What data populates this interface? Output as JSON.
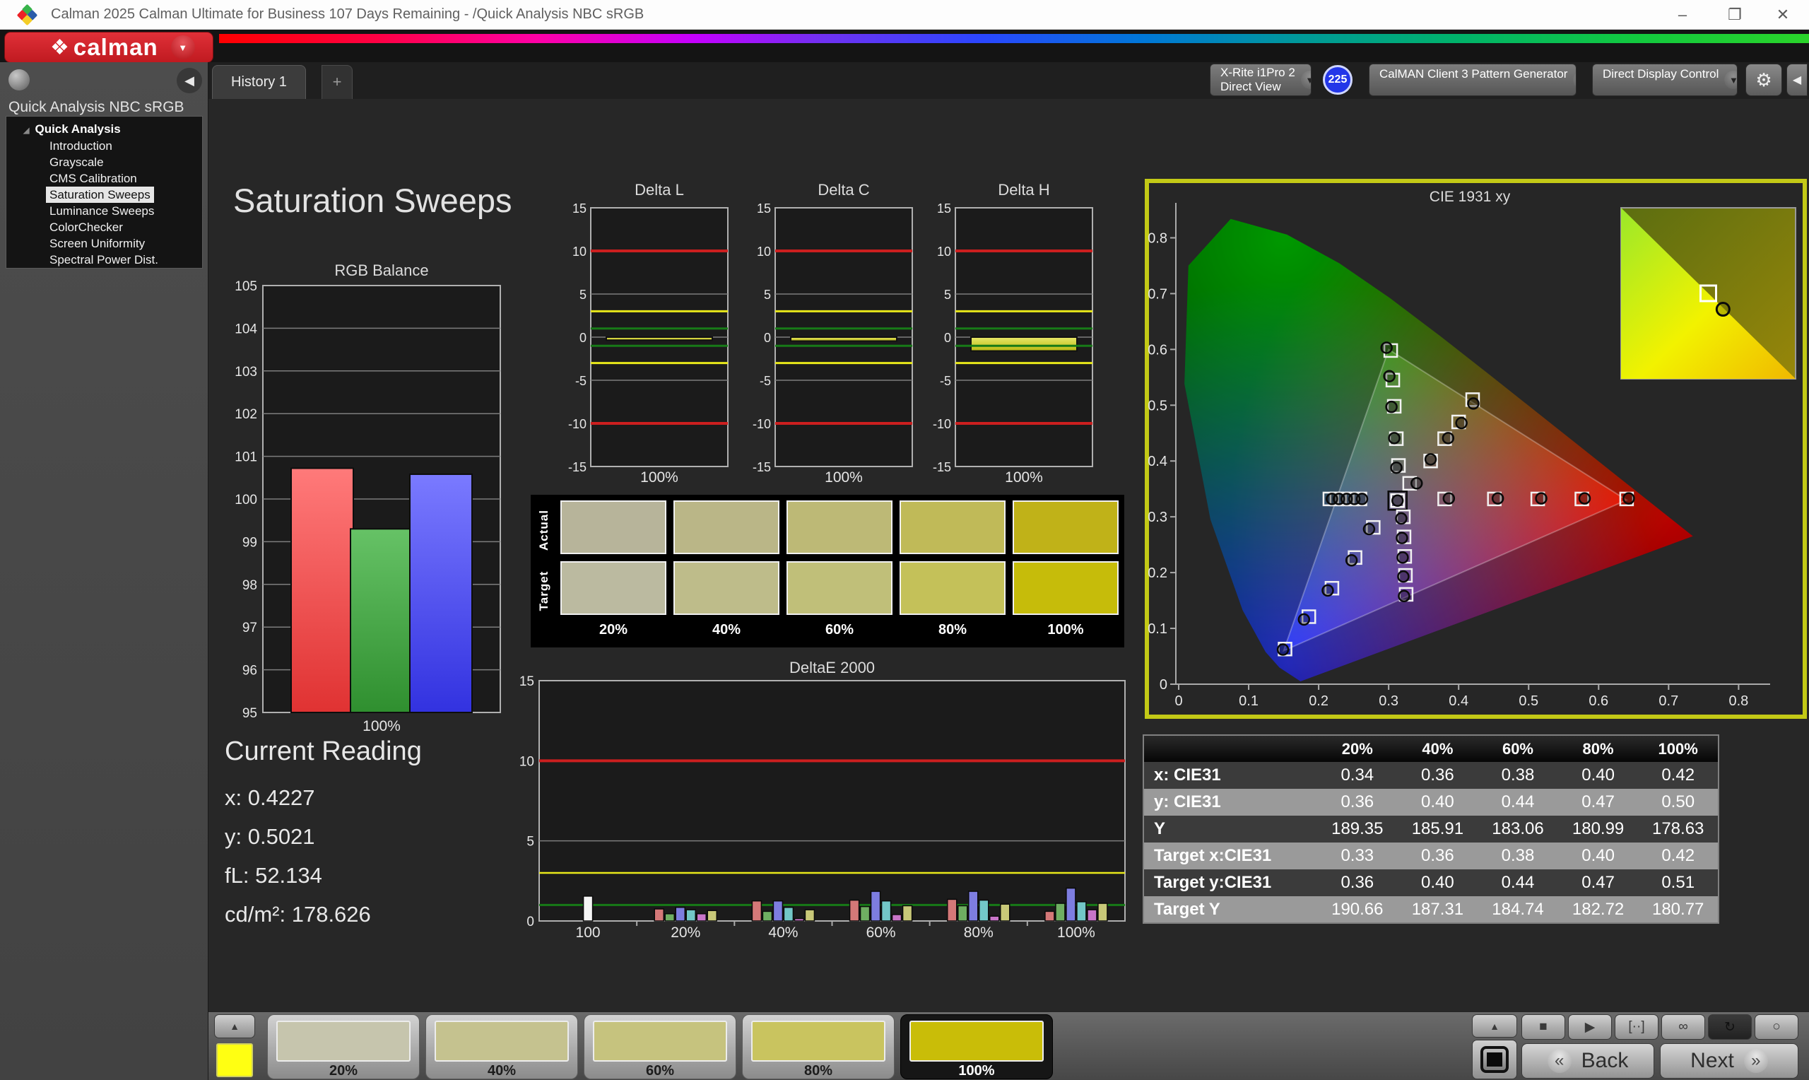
{
  "window": {
    "title": "Calman 2025 Calman Ultimate for Business 107 Days Remaining  - /Quick Analysis NBC sRGB"
  },
  "brand": {
    "logo_text": "calman",
    "logo_glyph": "❖"
  },
  "tab_bar": {
    "tabs": [
      {
        "label": "History 1",
        "active": true
      }
    ],
    "add_button": "+"
  },
  "toolbar": {
    "meter_dropdown": {
      "line1": "X-Rite i1Pro 2",
      "line2": "Direct View",
      "accent_color": "#3fd43f",
      "badge": "225",
      "badge_color": "#2336e8"
    },
    "source_dropdown": {
      "label": "CalMAN Client 3 Pattern Generator",
      "accent_color": "#3fd43f"
    },
    "display_dropdown": {
      "label": "Direct Display Control",
      "accent_color": "#e6e62a"
    },
    "settings_glyph": "⚙",
    "collapse_glyph": "◀"
  },
  "sidebar": {
    "workflow_title": "Quick Analysis NBC sRGB",
    "root": "Quick Analysis",
    "items": [
      "Introduction",
      "Grayscale",
      "CMS Calibration",
      "Saturation Sweeps",
      "Luminance Sweeps",
      "ColorChecker",
      "Screen Uniformity",
      "Spectral Power Dist."
    ],
    "selected_index": 3
  },
  "page_title": "Saturation Sweeps",
  "current_reading": {
    "title": "Current Reading",
    "lines": [
      "x: 0.4227",
      "y: 0.5021",
      "fL: 52.134",
      "cd/m²: 178.626"
    ]
  },
  "swatch_panel": {
    "row_labels": [
      "Actual",
      "Target"
    ],
    "columns": [
      "20%",
      "40%",
      "60%",
      "80%",
      "100%"
    ],
    "actual_colors": [
      "#b7b49a",
      "#bab687",
      "#bdb976",
      "#c0ba58",
      "#c0b218"
    ],
    "target_colors": [
      "#bbbaa0",
      "#bebc8a",
      "#c0bf79",
      "#c4c159",
      "#c6bc0a"
    ]
  },
  "results_table": {
    "headers": [
      "",
      "20%",
      "40%",
      "60%",
      "80%",
      "100%"
    ],
    "rows": [
      {
        "label": "x: CIE31",
        "values": [
          "0.34",
          "0.36",
          "0.38",
          "0.40",
          "0.42"
        ]
      },
      {
        "label": "y: CIE31",
        "values": [
          "0.36",
          "0.40",
          "0.44",
          "0.47",
          "0.50"
        ]
      },
      {
        "label": "Y",
        "values": [
          "189.35",
          "185.91",
          "183.06",
          "180.99",
          "178.63"
        ]
      },
      {
        "label": "Target x:CIE31",
        "values": [
          "0.33",
          "0.36",
          "0.38",
          "0.40",
          "0.42"
        ]
      },
      {
        "label": "Target y:CIE31",
        "values": [
          "0.36",
          "0.40",
          "0.44",
          "0.47",
          "0.51"
        ]
      },
      {
        "label": "Target Y",
        "values": [
          "190.66",
          "187.31",
          "184.74",
          "182.72",
          "180.77"
        ]
      }
    ]
  },
  "bottom_bar": {
    "up_glyph": "▲",
    "patterns": [
      {
        "label": "20%",
        "color": "#c6c5ad",
        "selected": false
      },
      {
        "label": "40%",
        "color": "#c5c28f",
        "selected": false
      },
      {
        "label": "60%",
        "color": "#c6c37e",
        "selected": false
      },
      {
        "label": "80%",
        "color": "#c9c45f",
        "selected": false
      },
      {
        "label": "100%",
        "color": "#c9bd08",
        "selected": true
      }
    ],
    "transport_icons": [
      {
        "name": "stop",
        "glyph": "■",
        "dark": false
      },
      {
        "name": "play",
        "glyph": "▶",
        "dark": false
      },
      {
        "name": "measure",
        "glyph": "[··]",
        "dark": false
      },
      {
        "name": "continuous",
        "glyph": "∞",
        "dark": false
      },
      {
        "name": "refresh",
        "glyph": "↻",
        "dark": true
      },
      {
        "name": "record",
        "glyph": "○",
        "dark": false
      }
    ],
    "back": "Back",
    "next": "Next"
  },
  "chart_data": [
    {
      "id": "rgb_balance",
      "type": "bar",
      "title": "RGB Balance",
      "categories": [
        "100%"
      ],
      "ylim": [
        95,
        105
      ],
      "yticks": [
        95,
        96,
        97,
        98,
        99,
        100,
        101,
        102,
        103,
        104,
        105
      ],
      "series": [
        {
          "name": "Red",
          "color_top": "#ff7a7a",
          "color_bottom": "#e03232",
          "values": [
            100.72
          ]
        },
        {
          "name": "Green",
          "color_top": "#66c266",
          "color_bottom": "#2f8f2f",
          "values": [
            99.3
          ]
        },
        {
          "name": "Blue",
          "color_top": "#7a7aff",
          "color_bottom": "#3232e0",
          "values": [
            100.58
          ]
        }
      ]
    },
    {
      "id": "delta_l",
      "type": "bar",
      "title": "Delta L",
      "categories": [
        "100%"
      ],
      "values": [
        -0.35
      ],
      "ylim": [
        -15,
        15
      ],
      "yticks": [
        -15,
        -10,
        -5,
        0,
        5,
        10,
        15
      ],
      "limits": {
        "error": 10,
        "warn": 3,
        "ok": 1
      }
    },
    {
      "id": "delta_c",
      "type": "bar",
      "title": "Delta C",
      "categories": [
        "100%"
      ],
      "values": [
        -0.45
      ],
      "ylim": [
        -15,
        15
      ],
      "yticks": [
        -15,
        -10,
        -5,
        0,
        5,
        10,
        15
      ],
      "limits": {
        "error": 10,
        "warn": 3,
        "ok": 1
      }
    },
    {
      "id": "delta_h",
      "type": "bar",
      "title": "Delta H",
      "categories": [
        "100%"
      ],
      "values": [
        -1.6
      ],
      "ylim": [
        -15,
        15
      ],
      "yticks": [
        -15,
        -10,
        -5,
        0,
        5,
        10,
        15
      ],
      "limits": {
        "error": 10,
        "warn": 3,
        "ok": 1
      }
    },
    {
      "id": "deltae_2000",
      "type": "bar",
      "title": "DeltaE 2000",
      "groups": [
        "100",
        "20%",
        "40%",
        "60%",
        "80%",
        "100%"
      ],
      "values": [
        [
          1.55
        ],
        [
          0.75,
          0.45,
          0.85,
          0.7,
          0.45,
          0.65
        ],
        [
          1.25,
          0.6,
          1.25,
          0.85,
          0.15,
          0.7
        ],
        [
          1.3,
          0.9,
          1.85,
          1.25,
          0.4,
          0.95
        ],
        [
          1.35,
          0.95,
          1.85,
          1.3,
          0.3,
          1.05
        ],
        [
          0.6,
          1.1,
          2.05,
          1.2,
          0.7,
          1.1
        ]
      ],
      "first_group_color": "#f5f5f5",
      "palette": [
        "#d47878",
        "#6fae62",
        "#7d7de0",
        "#72c7c7",
        "#c875c8",
        "#c8c878"
      ],
      "ylim": [
        0,
        15
      ],
      "yticks": [
        0,
        5,
        10,
        15
      ],
      "limits": {
        "error": 10,
        "warn": 3,
        "ok": 1
      }
    },
    {
      "id": "cie_1931",
      "type": "scatter",
      "title": "CIE 1931 xy",
      "xlim": [
        0,
        0.84
      ],
      "ylim": [
        0,
        0.85
      ],
      "xticks": [
        "0",
        "0.1",
        "0.2",
        "0.3",
        "0.4",
        "0.5",
        "0.6",
        "0.7",
        "0.8"
      ],
      "yticks": [
        "0",
        "0.1",
        "0.2",
        "0.3",
        "0.4",
        "0.5",
        "0.6",
        "0.7",
        "0.8"
      ],
      "gamut_triangle": {
        "red": [
          0.64,
          0.33
        ],
        "green": [
          0.3,
          0.6
        ],
        "blue": [
          0.15,
          0.06
        ]
      },
      "series": [
        {
          "name": "white-point",
          "current": true,
          "target": [
            [
              0.3127,
              0.329
            ]
          ],
          "measured": [
            [
              0.3127,
              0.329
            ]
          ]
        },
        {
          "name": "red-sweep",
          "target": [
            [
              0.38,
              0.332
            ],
            [
              0.451,
              0.332
            ],
            [
              0.513,
              0.332
            ],
            [
              0.576,
              0.332
            ],
            [
              0.64,
              0.332
            ]
          ],
          "measured": [
            [
              0.386,
              0.333
            ],
            [
              0.456,
              0.333
            ],
            [
              0.518,
              0.333
            ],
            [
              0.58,
              0.333
            ],
            [
              0.643,
              0.333
            ]
          ]
        },
        {
          "name": "green-sweep",
          "target": [
            [
              0.303,
              0.598
            ],
            [
              0.306,
              0.545
            ],
            [
              0.308,
              0.498
            ],
            [
              0.311,
              0.44
            ],
            [
              0.314,
              0.392
            ]
          ],
          "measured": [
            [
              0.297,
              0.603
            ],
            [
              0.301,
              0.552
            ],
            [
              0.304,
              0.497
            ],
            [
              0.308,
              0.441
            ],
            [
              0.311,
              0.388
            ]
          ]
        },
        {
          "name": "blue-sweep",
          "target": [
            [
              0.278,
              0.281
            ],
            [
              0.252,
              0.227
            ],
            [
              0.219,
              0.172
            ],
            [
              0.186,
              0.121
            ],
            [
              0.152,
              0.063
            ]
          ],
          "measured": [
            [
              0.272,
              0.278
            ],
            [
              0.247,
              0.222
            ],
            [
              0.213,
              0.168
            ],
            [
              0.179,
              0.116
            ],
            [
              0.149,
              0.062
            ]
          ]
        },
        {
          "name": "cyan-sweep",
          "target": [
            [
              0.216,
              0.332
            ],
            [
              0.226,
              0.332
            ],
            [
              0.237,
              0.332
            ],
            [
              0.248,
              0.332
            ],
            [
              0.259,
              0.332
            ]
          ],
          "measured": [
            [
              0.219,
              0.332
            ],
            [
              0.229,
              0.332
            ],
            [
              0.24,
              0.332
            ],
            [
              0.251,
              0.332
            ],
            [
              0.262,
              0.332
            ]
          ]
        },
        {
          "name": "magenta-sweep",
          "target": [
            [
              0.321,
              0.3
            ],
            [
              0.322,
              0.264
            ],
            [
              0.323,
              0.229
            ],
            [
              0.324,
              0.195
            ],
            [
              0.325,
              0.161
            ]
          ],
          "measured": [
            [
              0.318,
              0.297
            ],
            [
              0.319,
              0.262
            ],
            [
              0.32,
              0.227
            ],
            [
              0.321,
              0.193
            ],
            [
              0.322,
              0.158
            ]
          ]
        },
        {
          "name": "yellow-sweep",
          "target": [
            [
              0.33,
              0.36
            ],
            [
              0.36,
              0.4
            ],
            [
              0.38,
              0.44
            ],
            [
              0.4,
              0.47
            ],
            [
              0.42,
              0.51
            ]
          ],
          "measured": [
            [
              0.34,
              0.36
            ],
            [
              0.36,
              0.403
            ],
            [
              0.385,
              0.441
            ],
            [
              0.404,
              0.468
            ],
            [
              0.421,
              0.503
            ]
          ]
        }
      ],
      "inset": {
        "target_rel": [
          0.5,
          0.5
        ],
        "measured_rel": [
          0.56,
          0.56
        ]
      }
    }
  ]
}
